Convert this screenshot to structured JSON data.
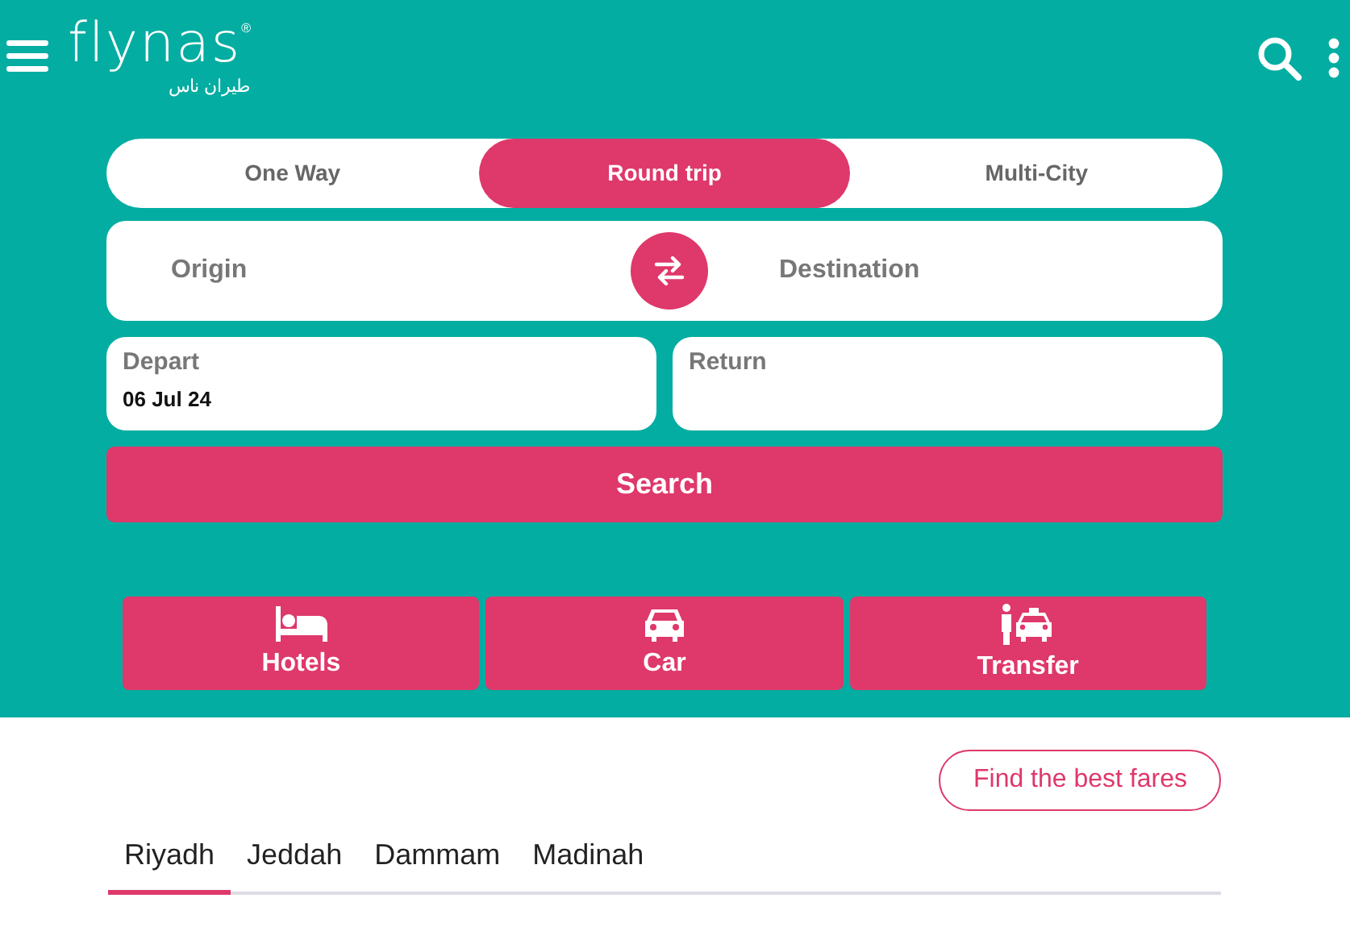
{
  "header": {
    "logo": "flynas",
    "logo_mark": "®",
    "logo_arabic": "طيران ناس"
  },
  "trip_types": [
    {
      "label": "One Way",
      "selected": false
    },
    {
      "label": "Round trip",
      "selected": true
    },
    {
      "label": "Multi-City",
      "selected": false
    }
  ],
  "route": {
    "origin_placeholder": "Origin",
    "destination_placeholder": "Destination"
  },
  "dates": [
    {
      "label": "Depart",
      "value": "06 Jul 24"
    },
    {
      "label": "Return"
    }
  ],
  "search_button": "Search",
  "services": [
    {
      "kind": "hotel",
      "label": "Hotels"
    },
    {
      "kind": "car",
      "label": "Car"
    },
    {
      "kind": "transfer",
      "label": "Transfer"
    }
  ],
  "best_fares_button": "Find the best fares",
  "city_tabs": [
    {
      "label": "Riyadh",
      "selected": true
    },
    {
      "label": "Jeddah",
      "selected": false
    },
    {
      "label": "Dammam",
      "selected": false
    },
    {
      "label": "Madinah",
      "selected": false
    }
  ]
}
